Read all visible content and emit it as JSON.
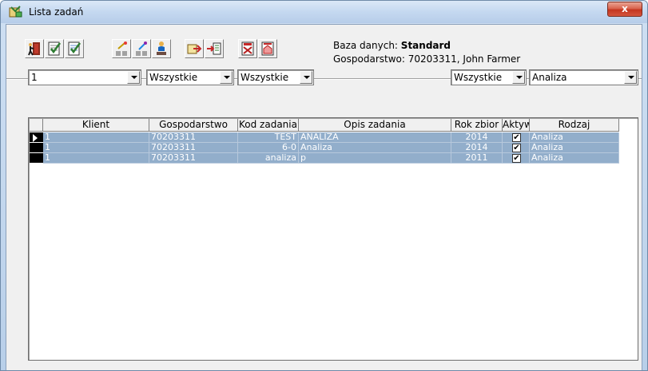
{
  "window": {
    "title": "Lista zadań",
    "close_label": "x"
  },
  "toolbar": {
    "buttons": [
      {
        "icon": "exit-door-icon"
      },
      {
        "icon": "checklist-icon"
      },
      {
        "icon": "checklist-edit-icon"
      },
      {
        "icon": "new-task-icon"
      },
      {
        "icon": "edit-task-icon"
      },
      {
        "icon": "worker-icon"
      },
      {
        "icon": "export-icon"
      },
      {
        "icon": "import-icon"
      },
      {
        "icon": "report-icon"
      },
      {
        "icon": "report-alt-icon"
      }
    ]
  },
  "info": {
    "db_label": "Baza danych: ",
    "db_value": "Standard",
    "farm_line": "Gospodarstwo: 70203311, John Farmer"
  },
  "filters": {
    "client": "1",
    "farm": "Wszystkie",
    "task": "Wszystkie",
    "status": "Wszystkie",
    "type": "Analiza"
  },
  "table": {
    "columns": [
      "Klient",
      "Gospodarstwo",
      "Kod zadania",
      "Opis zadania",
      "Rok zbior",
      "Aktyw",
      "Rodzaj"
    ],
    "rows": [
      {
        "klient": "1",
        "gospodarstwo": "70203311",
        "kod": "TEST",
        "opis": "ANALIZA",
        "rok": "2014",
        "aktywne": true,
        "rodzaj": "Analiza"
      },
      {
        "klient": "1",
        "gospodarstwo": "70203311",
        "kod": "6-0",
        "opis": "Analiza",
        "rok": "2014",
        "aktywne": true,
        "rodzaj": "Analiza"
      },
      {
        "klient": "1",
        "gospodarstwo": "70203311",
        "kod": "analiza",
        "opis": "p",
        "rok": "2011",
        "aktywne": true,
        "rodzaj": "Analiza"
      }
    ],
    "check_mark": "✔"
  },
  "colors": {
    "selection": "#92aecb",
    "title_bar": "#c4d8f0",
    "close": "#c4351f"
  }
}
